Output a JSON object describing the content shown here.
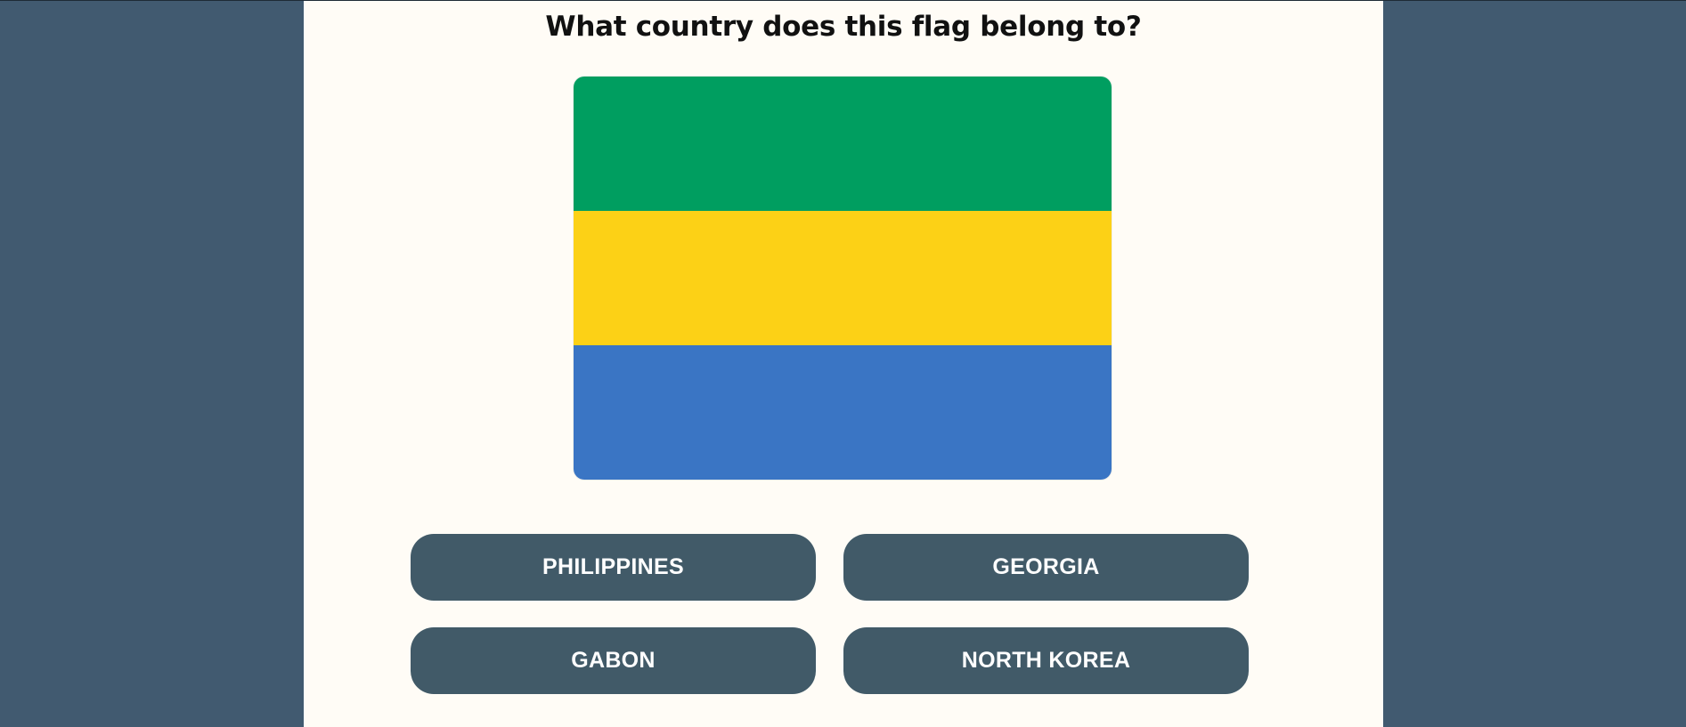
{
  "quiz": {
    "question": "What country does this flag belong to?",
    "flag": {
      "stripes": [
        "#009e60",
        "#fcd116",
        "#3a75c4"
      ]
    },
    "answers": [
      "PHILIPPINES",
      "GEORGIA",
      "GABON",
      "NORTH KOREA"
    ]
  },
  "colors": {
    "background": "#415a70",
    "panel": "#fffcf6",
    "button": "#415a68",
    "button_text": "#ffffff"
  }
}
